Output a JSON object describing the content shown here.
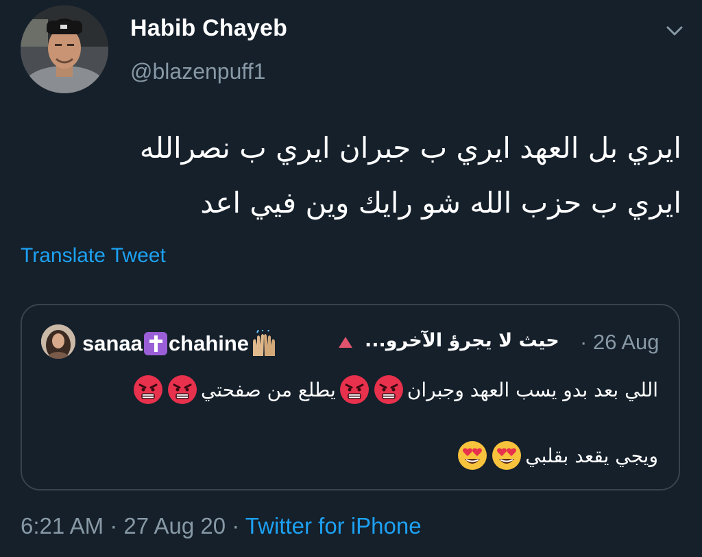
{
  "author": {
    "display_name": "Habib Chayeb",
    "handle": "@blazenpuff1"
  },
  "tweet": {
    "text_line1": "ايري بل العهد ايري ب جبران ايري ب نصرالله",
    "text_line2": "ايري ب حزب الله شو رايك وين فيي اعد",
    "translate_label": "Translate Tweet"
  },
  "quoted": {
    "name_part1": "sanaa",
    "name_part2": "chahine",
    "name_arabic": "حيث لا يجرؤ الآخرو...",
    "separator": "·",
    "date": "26 Aug",
    "line1_a": "اللي بعد بدو يسب العهد وجبران",
    "line1_b": "يطلع من صفحتي",
    "line2": "ويجي يقعد بقلبي",
    "icons": [
      "latin-cross-icon",
      "raising-hands-icon",
      "red-triangle-icon",
      "angry-face-icon",
      "heart-eyes-face-icon"
    ]
  },
  "footer": {
    "time": "6:21 AM",
    "sep1": " · ",
    "date": "27 Aug 20",
    "sep2": " · ",
    "source": "Twitter for iPhone"
  },
  "colors": {
    "background": "#15202b",
    "accent": "#1da1f2",
    "muted": "#8899a6",
    "border": "#38444d"
  }
}
